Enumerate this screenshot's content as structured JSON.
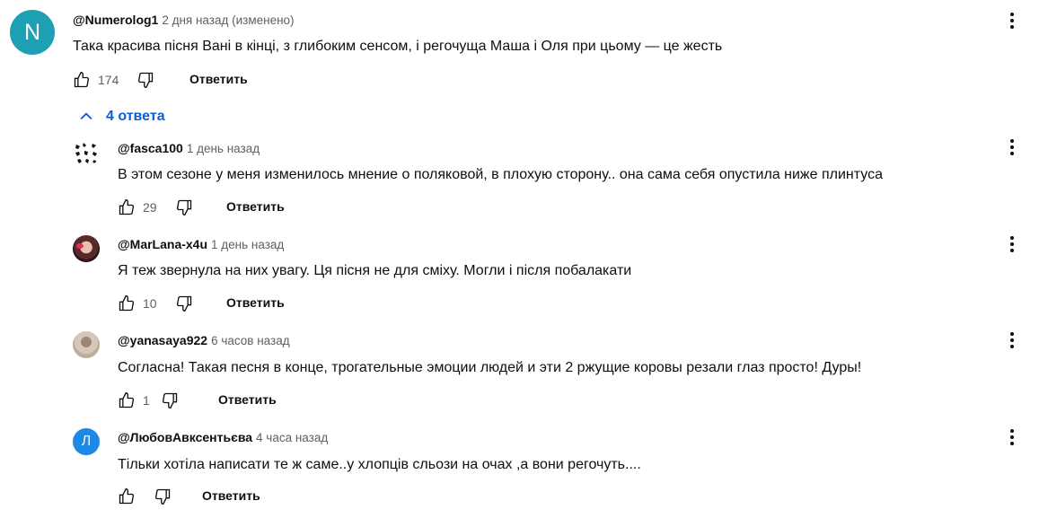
{
  "colors": {
    "link": "#065fd4",
    "meta": "#606060",
    "avatar_main": "#1ea0b4",
    "avatar_l": "#1e88e5"
  },
  "main_comment": {
    "avatar_letter": "N",
    "author": "@Numerolog1",
    "meta": "2 дня назад (изменено)",
    "text": "Така красива пісня Вані в кінці, з глибоким сенсом, і регочуща Маша і Оля при цьому — це жесть",
    "likes": "174",
    "reply_label": "Ответить"
  },
  "replies_toggle": {
    "label": "4 ответа",
    "icon": "chevron-up-icon"
  },
  "replies": [
    {
      "author": "@fasca100",
      "meta": "1 день назад",
      "text": "В этом сезоне у меня изменилось мнение о поляковой, в плохую сторону.. она сама себя опустила ниже плинтуса",
      "likes": "29",
      "reply_label": "Ответить",
      "avatar": "butterflies"
    },
    {
      "author": "@MarLana-x4u",
      "meta": "1 день назад",
      "text": "Я теж звернула на них увагу.  Ця пісня не для сміху.  Могли і після побалакати",
      "likes": "10",
      "reply_label": "Ответить",
      "avatar": "photo-red"
    },
    {
      "author": "@yanasaya922",
      "meta": "6 часов назад",
      "text": "Согласна! Такая песня в конце, трогательные эмоции людей и эти 2 ржущие коровы резали глаз просто! Дуры!",
      "likes": "1",
      "reply_label": "Ответить",
      "avatar": "photo-beige"
    },
    {
      "author": "@ЛюбовАвксентьєва",
      "meta": "4 часа назад",
      "text": "Тільки хотіла написати те ж саме..у хлопців сльози на очах ,а вони регочуть....",
      "likes": "",
      "reply_label": "Ответить",
      "avatar": "letter",
      "avatar_letter": "Л"
    }
  ]
}
